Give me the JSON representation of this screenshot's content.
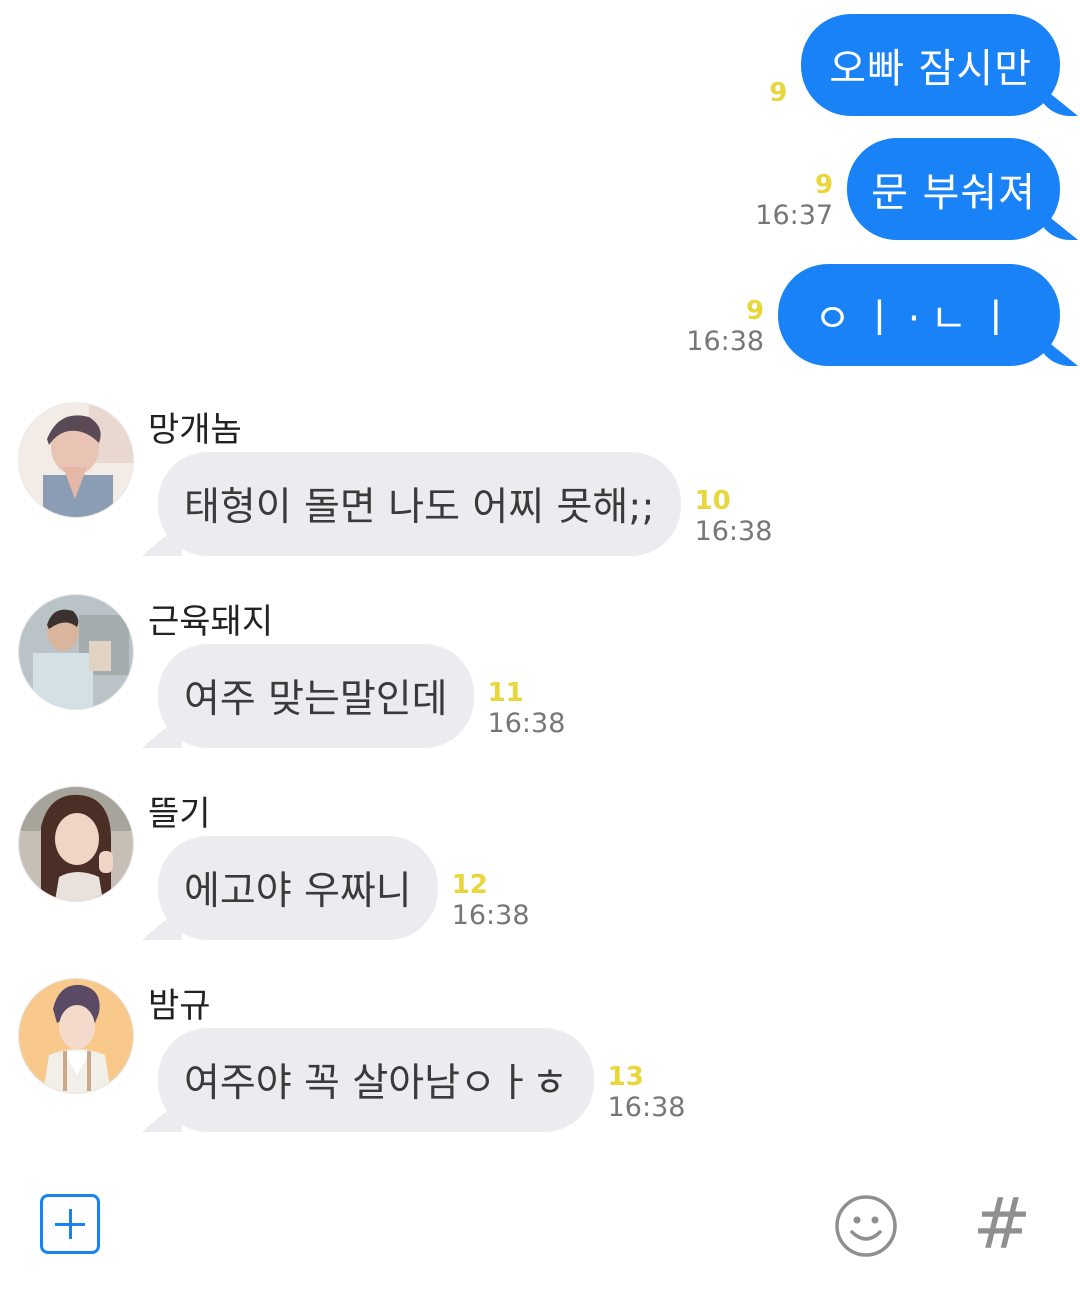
{
  "outgoing": [
    {
      "text": "오빠 잠시만",
      "read": "9",
      "time": ""
    },
    {
      "text": "문 부숴져",
      "read": "9",
      "time": "16:37"
    },
    {
      "text": "ㅇㅣ·ㄴㅣ",
      "read": "9",
      "time": "16:38"
    }
  ],
  "incoming": [
    {
      "sender": "망개놈",
      "text": "태형이 돌면 나도 어찌 못해;;",
      "read": "10",
      "time": "16:38"
    },
    {
      "sender": "근육돼지",
      "text": "여주 맞는말인데",
      "read": "11",
      "time": "16:38"
    },
    {
      "sender": "뜰기",
      "text": "에고야 우짜니",
      "read": "12",
      "time": "16:38"
    },
    {
      "sender": "밤규",
      "text": "여주야 꼭 살아남ㅇㅏㅎ",
      "read": "13",
      "time": "16:38"
    }
  ],
  "icons": {
    "add": "plus-square-icon",
    "emoji": "smiley-icon",
    "hash": "hashtag-icon"
  },
  "colors": {
    "outgoing_bubble": "#1a82f7",
    "incoming_bubble": "#ebebf0",
    "read_count": "#e8d63a"
  }
}
